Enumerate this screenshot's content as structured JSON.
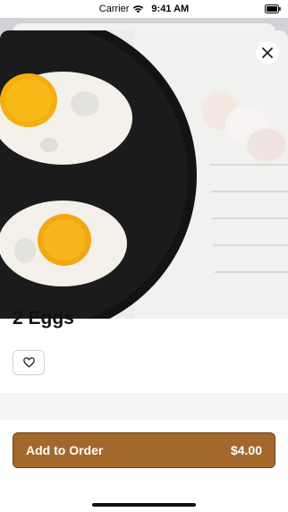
{
  "status_bar": {
    "carrier": "Carrier",
    "time": "9:41 AM"
  },
  "item": {
    "title": "2 Eggs",
    "image": "fried-eggs-photo"
  },
  "actions": {
    "close_icon": "close-icon",
    "favorite_icon": "heart-icon",
    "add_to_order_label": "Add to Order",
    "price": "$4.00"
  },
  "colors": {
    "accent": "#a2682c",
    "accent_border": "#6f4513",
    "section_gap": "#f5f5f5"
  }
}
